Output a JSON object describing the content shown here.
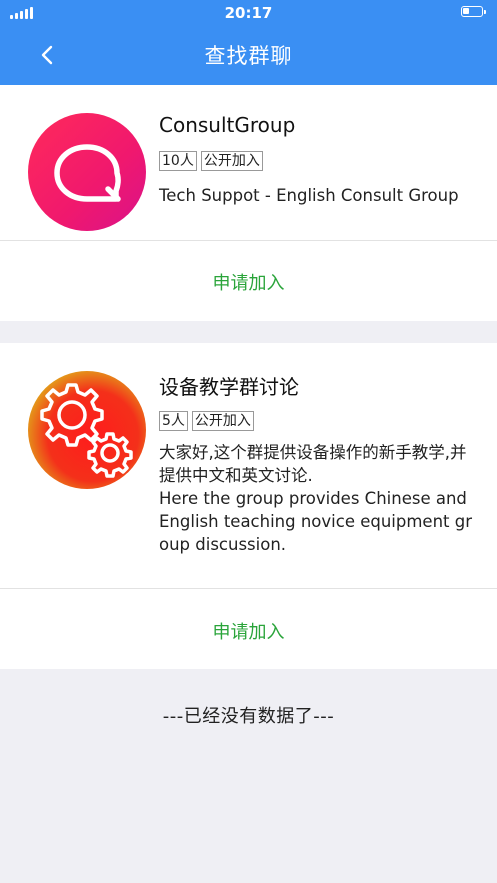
{
  "status_bar": {
    "time": "20:17"
  },
  "nav": {
    "title": "查找群聊",
    "back_icon": "chevron-left-icon"
  },
  "groups": [
    {
      "name": "ConsultGroup",
      "members": "10人",
      "join_type": "公开加入",
      "description": "Tech Suppot - English Consult Group",
      "join_label": "申请加入",
      "avatar_icon": "chat-bubble-icon"
    },
    {
      "name": "设备教学群讨论",
      "members": "5人",
      "join_type": "公开加入",
      "description": "大家好,这个群提供设备操作的新手教学,并提供中文和英文讨论.\nHere the group provides Chinese and English teaching novice equipment group discussion.",
      "join_label": "申请加入",
      "avatar_icon": "gears-icon"
    }
  ],
  "footer": {
    "text": "---已经没有数据了---"
  },
  "colors": {
    "accent": "#3a8ff3",
    "join": "#2aa43a"
  }
}
